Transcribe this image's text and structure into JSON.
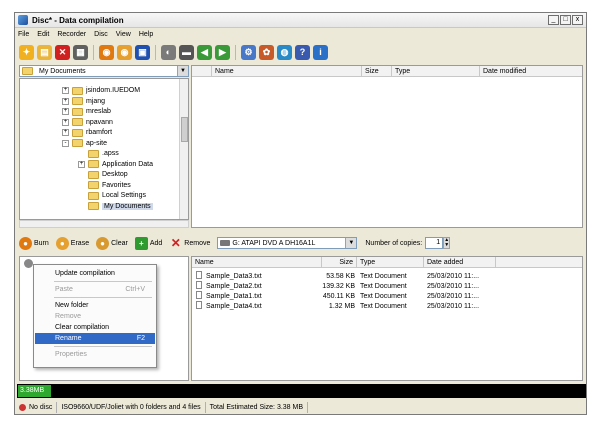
{
  "window": {
    "title": "Disc* - Data compilation"
  },
  "menu": [
    "File",
    "Edit",
    "Recorder",
    "Disc",
    "View",
    "Help"
  ],
  "toolbar_icons": [
    {
      "name": "new-icon",
      "color": "#f0b020",
      "glyph": "✦"
    },
    {
      "name": "open-folder-icon",
      "color": "#e9b53c",
      "glyph": "▤"
    },
    {
      "name": "delete-icon",
      "color": "#d02020",
      "glyph": "✕"
    },
    {
      "name": "print-icon",
      "color": "#606060",
      "glyph": "▦"
    },
    {
      "name": "burn-icon",
      "color": "#e07a10",
      "glyph": "◉"
    },
    {
      "name": "erase-icon",
      "color": "#e6a030",
      "glyph": "◉"
    },
    {
      "name": "save-icon",
      "color": "#2050b0",
      "glyph": "▣"
    },
    {
      "name": "copy-disc-icon",
      "color": "#7a7a7a",
      "glyph": "◐"
    },
    {
      "name": "drive-icon",
      "color": "#555555",
      "glyph": "▬"
    },
    {
      "name": "back-icon",
      "color": "#3a9a3a",
      "glyph": "◀"
    },
    {
      "name": "forward-icon",
      "color": "#3a9a3a",
      "glyph": "▶"
    },
    {
      "name": "settings-icon",
      "color": "#4a78c8",
      "glyph": "⚙"
    },
    {
      "name": "tools-icon",
      "color": "#c85a2a",
      "glyph": "✿"
    },
    {
      "name": "globe-icon",
      "color": "#2a8ac8",
      "glyph": "◍"
    },
    {
      "name": "help-icon",
      "color": "#3a5ab0",
      "glyph": "?"
    },
    {
      "name": "info-icon",
      "color": "#2a70c8",
      "glyph": "i"
    }
  ],
  "path_combo": {
    "value": "My Documents"
  },
  "tree": [
    {
      "label": "jsindom.IUEDOM",
      "level": 1,
      "expander": "+"
    },
    {
      "label": "mjang",
      "level": 1,
      "expander": "+"
    },
    {
      "label": "mreslab",
      "level": 1,
      "expander": "+"
    },
    {
      "label": "npavann",
      "level": 1,
      "expander": "+"
    },
    {
      "label": "rbamfort",
      "level": 1,
      "expander": "+"
    },
    {
      "label": "ap-site",
      "level": 1,
      "expander": "-"
    },
    {
      "label": ".apss",
      "level": 2,
      "expander": ""
    },
    {
      "label": "Application Data",
      "level": 2,
      "expander": "+"
    },
    {
      "label": "Desktop",
      "level": 2,
      "expander": ""
    },
    {
      "label": "Favorites",
      "level": 2,
      "expander": ""
    },
    {
      "label": "Local Settings",
      "level": 2,
      "expander": ""
    },
    {
      "label": "My Documents",
      "level": 2,
      "expander": "",
      "selected": true
    }
  ],
  "top_columns": {
    "name": "Name",
    "size": "Size",
    "type": "Type",
    "date": "Date modified"
  },
  "mid_toolbar": {
    "burn": "Burn",
    "erase": "Erase",
    "clear": "Clear",
    "add": "Add",
    "remove": "Remove",
    "drive": "G: ATAPI DVD A  DH16A1L",
    "copies_label": "Number of copies:",
    "copies_value": "1"
  },
  "context_menu": [
    {
      "label": "Update compilation",
      "state": "normal"
    },
    {
      "sep": true
    },
    {
      "label": "Paste",
      "shortcut": "Ctrl+V",
      "state": "disabled"
    },
    {
      "sep": true
    },
    {
      "label": "New folder",
      "state": "normal"
    },
    {
      "label": "Remove",
      "state": "disabled"
    },
    {
      "label": "Clear compilation",
      "state": "normal"
    },
    {
      "label": "Rename",
      "shortcut": "F2",
      "state": "highlighted"
    },
    {
      "sep": true
    },
    {
      "label": "Properties",
      "state": "disabled"
    }
  ],
  "bottom_columns": {
    "name": "Name",
    "size": "Size",
    "type": "Type",
    "date": "Date added"
  },
  "files": [
    {
      "name": "Sample_Data3.txt",
      "size": "53.58 KB",
      "type": "Text Document",
      "date": "25/03/2010 11:..."
    },
    {
      "name": "Sample_Data2.txt",
      "size": "139.32 KB",
      "type": "Text Document",
      "date": "25/03/2010 11:..."
    },
    {
      "name": "Sample_Data1.txt",
      "size": "450.11 KB",
      "type": "Text Document",
      "date": "25/03/2010 11:..."
    },
    {
      "name": "Sample_Data4.txt",
      "size": "1.32 MB",
      "type": "Text Document",
      "date": "25/03/2010 11:..."
    }
  ],
  "capacity": {
    "label": "3.38MB",
    "fill_fraction": 0.058
  },
  "status": {
    "disc": "No disc",
    "format": "ISO9660/UDF/Joliet with 0 folders and 4 files",
    "total": "Total Estimated Size: 3.38 MB"
  }
}
